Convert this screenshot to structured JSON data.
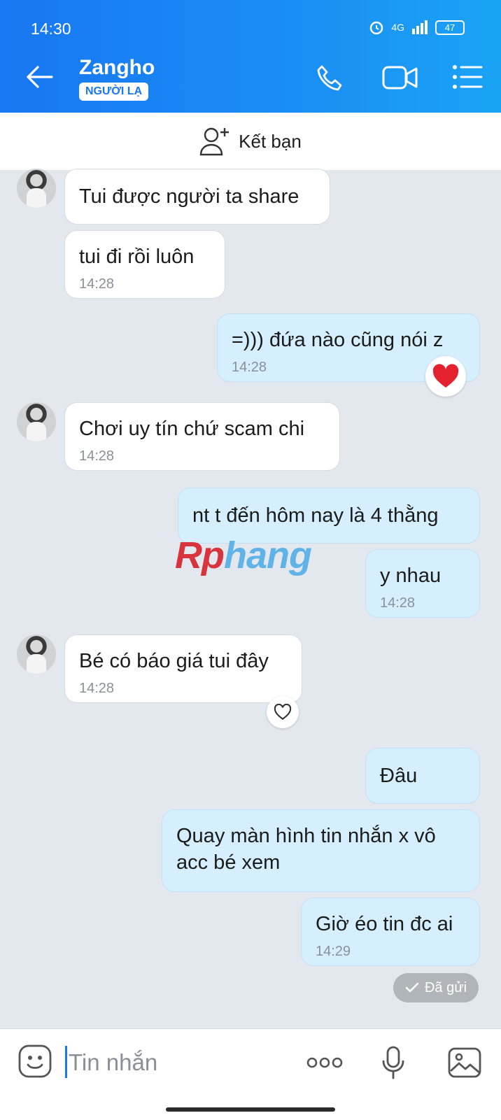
{
  "status_bar": {
    "time": "14:30",
    "network": "4G",
    "battery": "47"
  },
  "header": {
    "contact_name": "Zangho",
    "badge": "NGƯỜI LẠ"
  },
  "add_friend": {
    "label": "Kết bạn"
  },
  "watermark": {
    "part1": "Rp",
    "part2": "hang"
  },
  "messages": [
    {
      "dir": "in",
      "text": "Tui được người ta share"
    },
    {
      "dir": "in",
      "text": "tui đi rồi luôn",
      "time": "14:28"
    },
    {
      "dir": "out",
      "text": "=))) đứa nào cũng nói z",
      "time": "14:28",
      "reaction": "heart"
    },
    {
      "dir": "in",
      "text": "Chơi uy tín chứ scam chi",
      "time": "14:28"
    },
    {
      "dir": "out",
      "text": "nt t đến hôm nay là 4 thằng"
    },
    {
      "dir": "out",
      "text": "y nhau",
      "time": "14:28"
    },
    {
      "dir": "in",
      "text": "Bé có báo giá tui đây",
      "time": "14:28"
    },
    {
      "dir": "out",
      "text": "Đâu"
    },
    {
      "dir": "out",
      "text_line1": "Quay màn hình tin nhắn x vô",
      "text_line2": "acc bé xem"
    },
    {
      "dir": "out",
      "text": "Giờ éo tin đc ai",
      "time": "14:29"
    }
  ],
  "sent_status": "Đã gửi",
  "composer": {
    "placeholder": "Tin nhắn"
  },
  "colors": {
    "header": "#1877f2",
    "outgoing_bubble": "#d5efff",
    "chat_bg": "#e3e8ee"
  }
}
